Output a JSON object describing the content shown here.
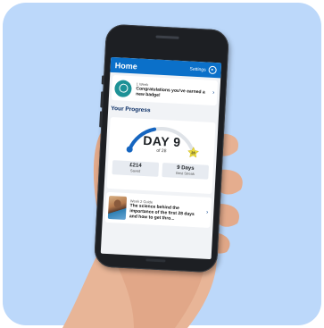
{
  "header": {
    "title": "Home",
    "settings_label": "Settings"
  },
  "badge": {
    "period": "1 Week",
    "message": "Congratulations you've earned a new badge!"
  },
  "progress": {
    "section_title": "Your Progress",
    "day_label": "DAY 9",
    "of_label": "of 28",
    "day_current": 9,
    "day_total": 28,
    "milestone": "28",
    "saved_value": "£214",
    "saved_label": "Saved",
    "streak_value": "9 Days",
    "streak_label": "Best Streak"
  },
  "guide": {
    "tag": "Week 2 Guide",
    "title": "The science behind the importance of the first 28 days and how to get thro..."
  },
  "colors": {
    "background": "#bcd8fa",
    "header": "#0b70c9",
    "badge_icon": "#1d9196",
    "dial_progress": "#1565c0",
    "dial_track": "#dfe3e8",
    "milestone_star": "#f0df3c"
  }
}
